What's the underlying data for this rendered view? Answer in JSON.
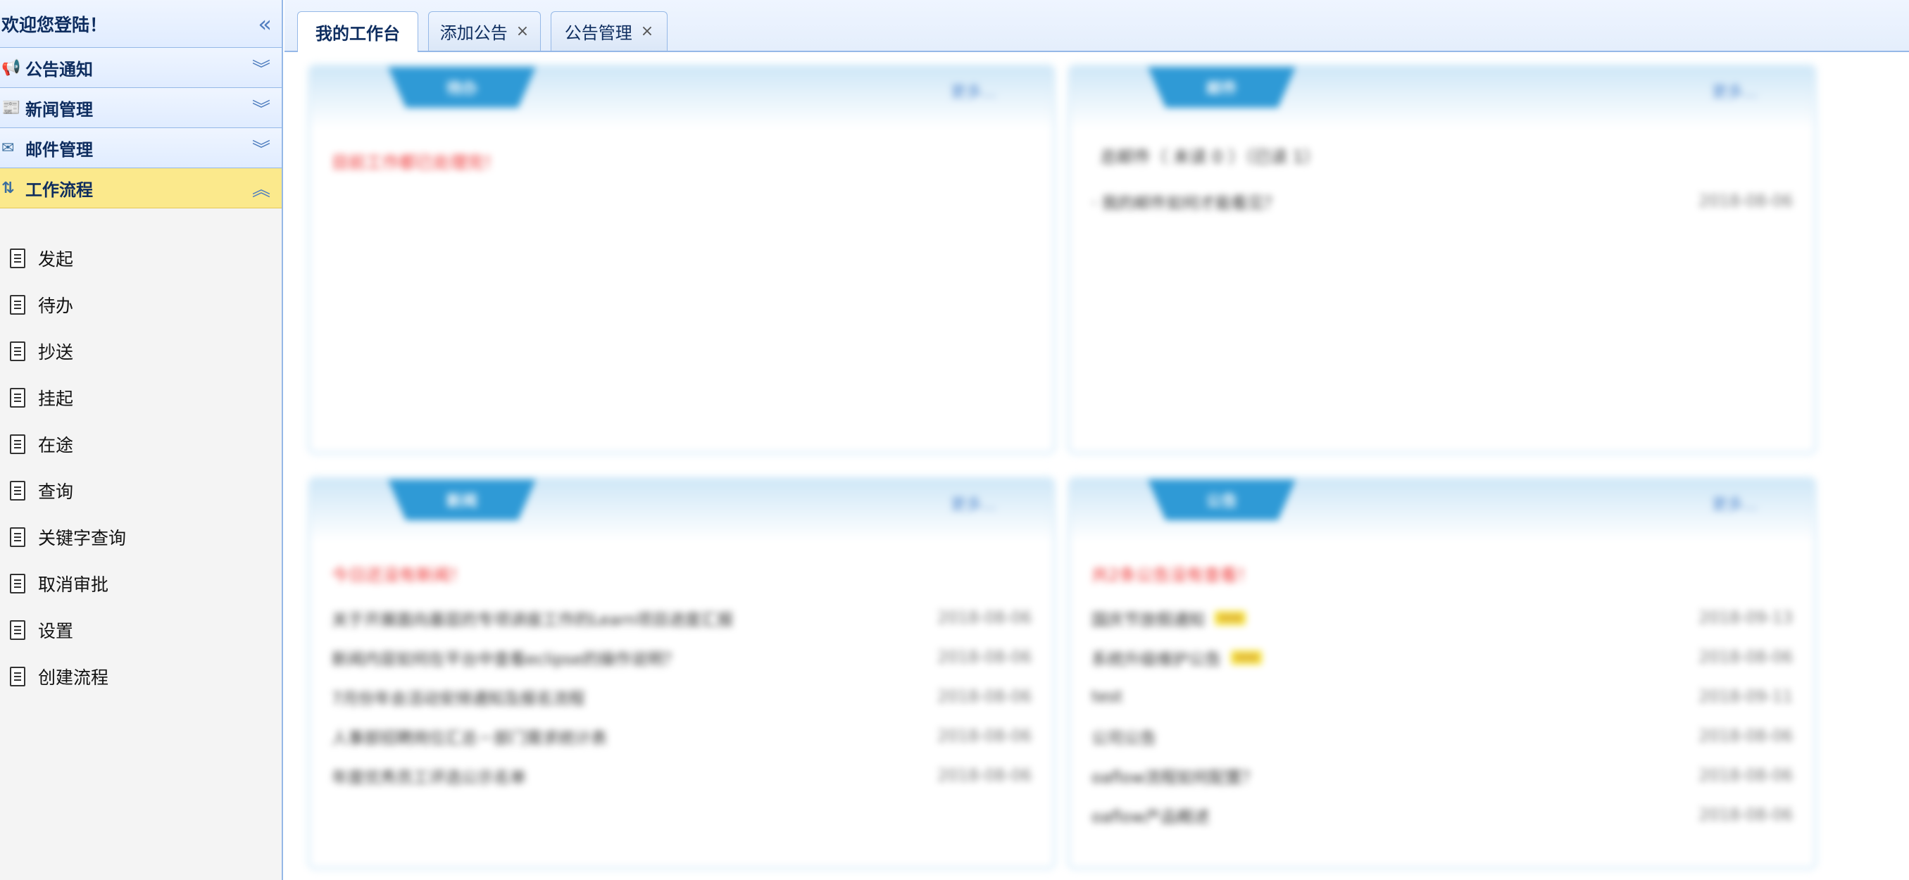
{
  "sidebar": {
    "header_title": "欢迎您登陆！",
    "collapse_icon": "double-chevron-left-icon",
    "panels": [
      {
        "label": "公告通知",
        "icon": "megaphone-icon",
        "state": "collapsed"
      },
      {
        "label": "新闻管理",
        "icon": "news-icon",
        "state": "collapsed"
      },
      {
        "label": "邮件管理",
        "icon": "mail-icon",
        "state": "collapsed"
      },
      {
        "label": "工作流程",
        "icon": "workflow-icon",
        "state": "expanded"
      }
    ],
    "workflow_items": [
      {
        "label": "发起"
      },
      {
        "label": "待办"
      },
      {
        "label": "抄送"
      },
      {
        "label": "挂起"
      },
      {
        "label": "在途"
      },
      {
        "label": "查询"
      },
      {
        "label": "关键字查询"
      },
      {
        "label": "取消审批"
      },
      {
        "label": "设置"
      },
      {
        "label": "创建流程"
      }
    ]
  },
  "tabs": [
    {
      "label": "我的工作台",
      "closable": false,
      "selected": true
    },
    {
      "label": "添加公告",
      "closable": true,
      "selected": false,
      "close_glyph": "×"
    },
    {
      "label": "公告管理",
      "closable": true,
      "selected": false,
      "close_glyph": "×"
    }
  ],
  "portal": {
    "colors": {
      "accent": "#2f9ad6",
      "note_red": "#e33333",
      "panel_border": "#95b8e7",
      "active_panel": "#fbe98c"
    },
    "cards": [
      {
        "tab_label": "待办",
        "more": "更多...",
        "note": "目前工作都已处理完！",
        "rows": []
      },
      {
        "tab_label": "邮件",
        "more": "更多...",
        "summary": "总邮件（ 未读 0 ）（已读 1）",
        "rows": [
          {
            "text": "· 我的邮件如何才能看见？",
            "date": "2018-08-06"
          }
        ]
      },
      {
        "tab_label": "新闻",
        "more": "更多...",
        "note": "今日还没有新闻！",
        "rows": [
          {
            "text": "关于开展面向基层的专项讲座工作的Learn项目进度汇报",
            "date": "2018-08-06"
          },
          {
            "text": "新闻内容如何在平台中查看eclipse的操作说明？",
            "date": "2018-08-06"
          },
          {
            "text": "7月份年会活动安排通知及报名流程",
            "date": "2018-08-06"
          },
          {
            "text": "人事部招聘岗位汇总－部门需求统计表",
            "date": "2018-08-06"
          },
          {
            "text": "年度优秀员工评选公示名单",
            "date": "2018-08-06"
          }
        ]
      },
      {
        "tab_label": "公告",
        "more": "更多...",
        "note": "共2条公告没有查看！",
        "rows": [
          {
            "text": "国庆节放假通知",
            "date": "2018-09-13",
            "new": "new"
          },
          {
            "text": "系统升级维护公告",
            "date": "2018-08-06",
            "new": "new"
          },
          {
            "text": "test",
            "date": "2018-09-11"
          },
          {
            "text": "公司公告",
            "date": "2018-08-06"
          },
          {
            "text": "oaflow流程如何配置？",
            "date": "2018-08-06"
          },
          {
            "text": "oaflow产品概述",
            "date": "2018-08-06"
          }
        ]
      }
    ]
  }
}
